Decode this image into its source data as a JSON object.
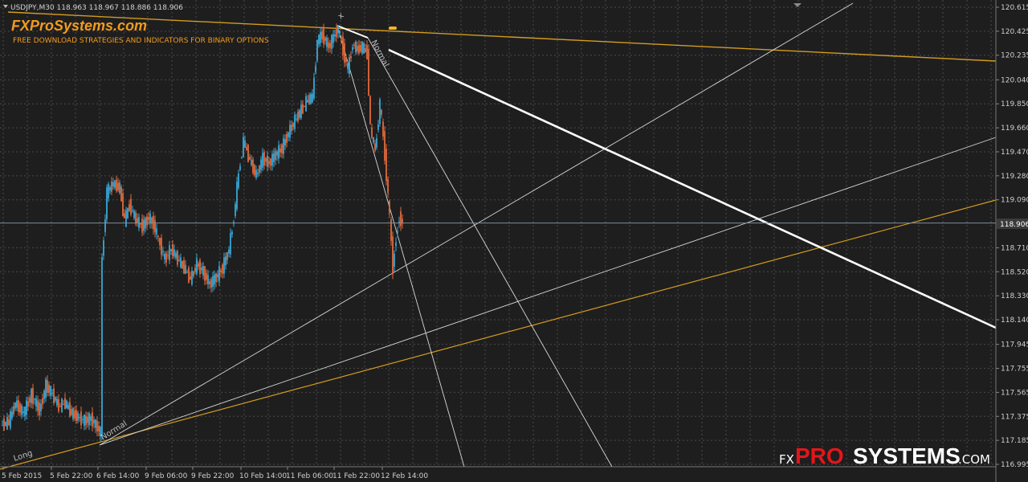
{
  "header": {
    "symbol_line": "USDJPY,M30  118.963 118.967 118.886 118.906",
    "brand_title": "FXProSystems.com",
    "brand_tagline": "FREE DOWNLOAD STRATEGIES AND INDICATORS FOR BINARY OPTIONS"
  },
  "watermark": {
    "prefix": "FX",
    "main": "PROSYSTEMS",
    "suffix": ".COM"
  },
  "labels": {
    "normal_1": "Normal",
    "normal_2": "Normal",
    "long": "Long",
    "x_mark": "x"
  },
  "colors": {
    "background": "#1e1e1e",
    "grid": "#4a4a4a",
    "bull": "#3aa7d6",
    "bear": "#e06a3c",
    "orange_line": "#d49b1f",
    "white_line": "#ffffff",
    "brand": "#f29b1d",
    "price_badge": "#3b3b3b"
  },
  "chart_data": {
    "type": "line",
    "title": "USDJPY,M30",
    "ylim": [
      116.995,
      120.615
    ],
    "y_ticks": [
      120.615,
      120.425,
      120.235,
      120.04,
      119.85,
      119.66,
      119.47,
      119.28,
      119.09,
      118.906,
      118.71,
      118.52,
      118.33,
      118.14,
      117.945,
      117.755,
      117.565,
      117.375,
      117.185,
      116.995
    ],
    "x_ticks": [
      "5 Feb 2015",
      "5 Feb 22:00",
      "6 Feb 14:00",
      "9 Feb 06:00",
      "9 Feb 22:00",
      "10 Feb 14:00",
      "11 Feb 06:00",
      "11 Feb 22:00",
      "12 Feb 14:00"
    ],
    "current_price": 118.906,
    "grid": true,
    "series": [
      {
        "name": "USDJPY",
        "points": [
          [
            0,
            117.3
          ],
          [
            10,
            117.33
          ],
          [
            18,
            117.48
          ],
          [
            28,
            117.4
          ],
          [
            38,
            117.55
          ],
          [
            48,
            117.42
          ],
          [
            56,
            117.62
          ],
          [
            64,
            117.55
          ],
          [
            72,
            117.45
          ],
          [
            80,
            117.48
          ],
          [
            88,
            117.4
          ],
          [
            96,
            117.37
          ],
          [
            104,
            117.34
          ],
          [
            112,
            117.36
          ],
          [
            120,
            117.29
          ],
          [
            124,
            117.24
          ],
          [
            126,
            118.62
          ],
          [
            132,
            119.15
          ],
          [
            140,
            119.22
          ],
          [
            148,
            119.18
          ],
          [
            154,
            118.92
          ],
          [
            160,
            119.05
          ],
          [
            168,
            118.93
          ],
          [
            176,
            118.88
          ],
          [
            184,
            118.95
          ],
          [
            190,
            118.9
          ],
          [
            196,
            118.78
          ],
          [
            204,
            118.62
          ],
          [
            212,
            118.7
          ],
          [
            220,
            118.62
          ],
          [
            228,
            118.55
          ],
          [
            236,
            118.46
          ],
          [
            244,
            118.58
          ],
          [
            252,
            118.52
          ],
          [
            260,
            118.42
          ],
          [
            268,
            118.48
          ],
          [
            276,
            118.55
          ],
          [
            284,
            118.7
          ],
          [
            290,
            118.95
          ],
          [
            296,
            119.3
          ],
          [
            302,
            119.55
          ],
          [
            310,
            119.4
          ],
          [
            318,
            119.28
          ],
          [
            326,
            119.42
          ],
          [
            334,
            119.38
          ],
          [
            342,
            119.45
          ],
          [
            350,
            119.5
          ],
          [
            358,
            119.62
          ],
          [
            366,
            119.72
          ],
          [
            374,
            119.8
          ],
          [
            382,
            119.88
          ],
          [
            388,
            119.9
          ],
          [
            394,
            120.35
          ],
          [
            400,
            120.4
          ],
          [
            408,
            120.3
          ],
          [
            414,
            120.38
          ],
          [
            420,
            120.45
          ],
          [
            426,
            120.28
          ],
          [
            432,
            120.12
          ],
          [
            438,
            120.32
          ],
          [
            444,
            120.28
          ],
          [
            450,
            120.3
          ],
          [
            456,
            120.25
          ],
          [
            460,
            119.65
          ],
          [
            466,
            119.48
          ],
          [
            472,
            119.85
          ],
          [
            478,
            119.45
          ],
          [
            484,
            118.95
          ],
          [
            488,
            118.55
          ],
          [
            492,
            118.8
          ],
          [
            496,
            118.95
          ],
          [
            500,
            118.91
          ]
        ]
      }
    ]
  }
}
